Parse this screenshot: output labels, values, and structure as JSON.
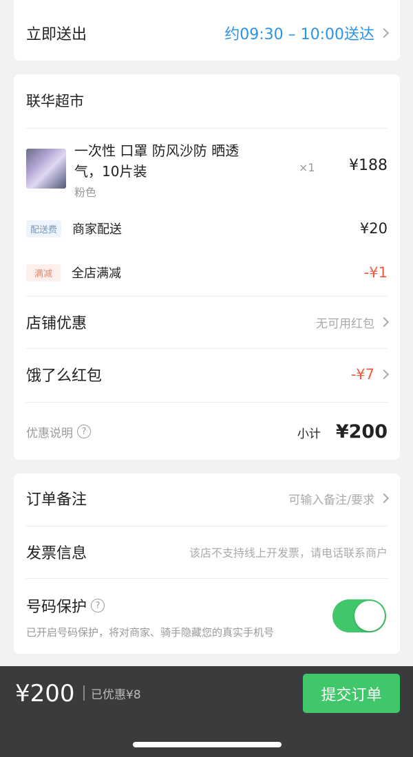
{
  "delivery": {
    "label": "立即送出",
    "time": "约09:30 – 10:00送达"
  },
  "store": {
    "name": "联华超市",
    "product": {
      "title_line1": "一次性 口罩 防风沙防 晒透",
      "title_line2": "气，10片装",
      "variant": "粉色",
      "qty": "×1",
      "price": "¥188"
    },
    "delivery_fee": {
      "tag": "配送费",
      "label": "商家配送",
      "value": "¥20"
    },
    "discount": {
      "tag": "满减",
      "label": "全店满减",
      "value": "-¥1"
    },
    "store_promo": {
      "label": "店铺优惠",
      "value": "无可用红包"
    },
    "redpacket": {
      "label": "饿了么红包",
      "value": "-¥7"
    },
    "explain": "优惠说明",
    "qmark": "?",
    "subtotal_label": "小计",
    "subtotal_value": "¥200"
  },
  "extras": {
    "note_label": "订单备注",
    "note_placeholder": "可输入备注/要求",
    "invoice_label": "发票信息",
    "invoice_value": "该店不支持线上开发票，请电话联系商户",
    "protect_label": "号码保护",
    "qmark": "?",
    "protect_desc": "已开启号码保护，将对商家、骑手隐藏您的真实手机号",
    "protect_on": true
  },
  "bottom_bar": {
    "total": "¥200",
    "saved": "已优惠¥8",
    "submit": "提交订单"
  },
  "colors": {
    "accent_blue": "#2b93e8",
    "accent_red": "#f05a3a",
    "green": "#3fc76a",
    "bar_bg": "#3b3b3d"
  }
}
